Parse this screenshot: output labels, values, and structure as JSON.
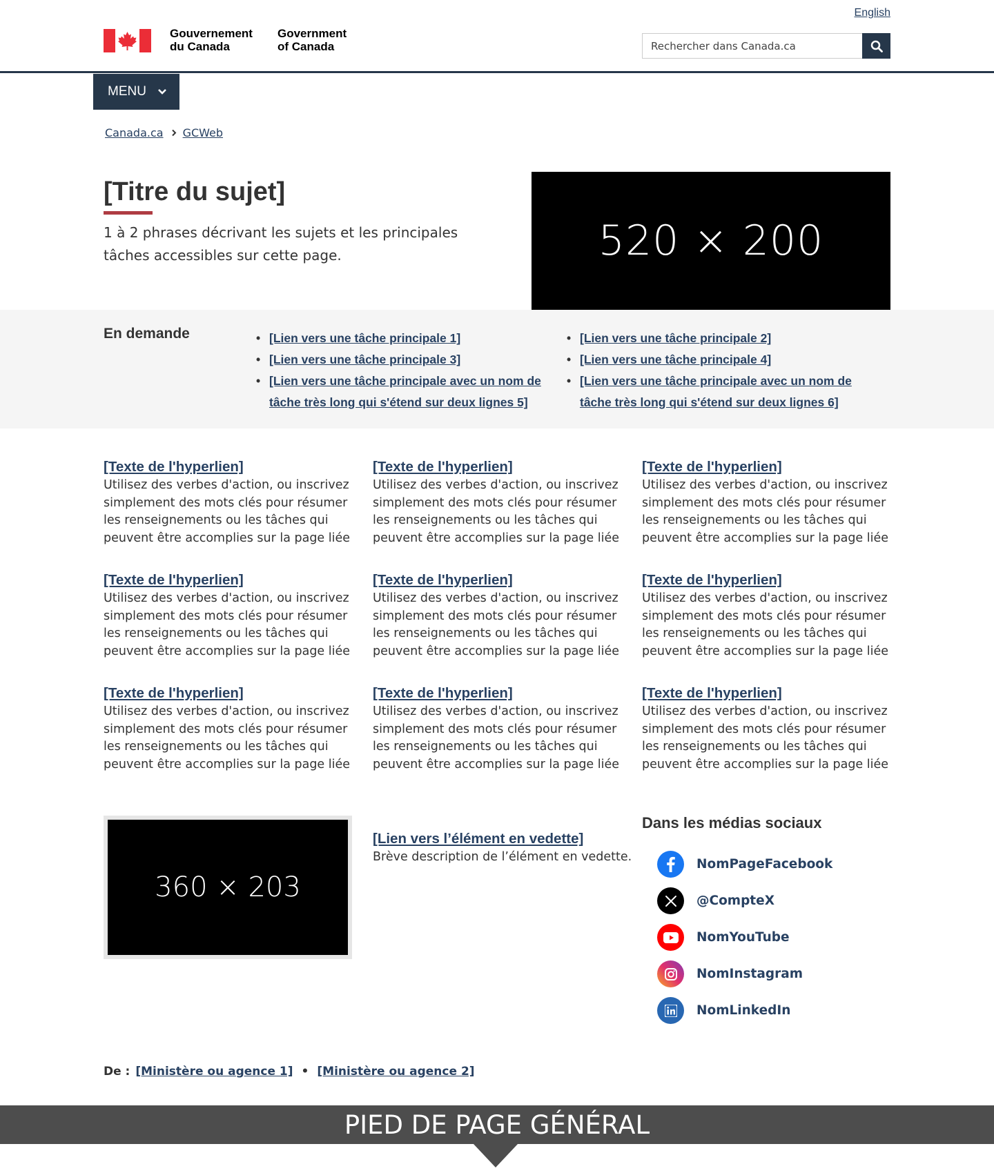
{
  "header": {
    "lang_link": "English",
    "signature_fr": [
      "Gouvernement",
      "du Canada"
    ],
    "signature_en": [
      "Government",
      "of Canada"
    ],
    "search": {
      "placeholder": "Rechercher dans Canada.ca",
      "button_icon": "search-icon"
    },
    "menu_label": "MENU"
  },
  "breadcrumb": [
    "Canada.ca",
    "GCWeb"
  ],
  "hero": {
    "title": "[Titre du sujet]",
    "intro": "1 à 2 phrases décrivant les sujets et les principales tâches accessibles sur cette page.",
    "image_label": "520 × 200"
  },
  "most_requested": {
    "heading": "En demande",
    "col1": [
      "[Lien vers une tâche principale 1]",
      "[Lien vers une tâche principale 3]",
      "[Lien vers une tâche principale avec un nom de tâche très long qui s'étend sur deux lignes 5]"
    ],
    "col2": [
      "[Lien vers une tâche principale 2]",
      "[Lien vers une tâche principale 4]",
      "[Lien vers une tâche principale avec un nom de tâche très long qui s'étend sur deux lignes 6]"
    ]
  },
  "links": [
    {
      "title": "[Texte de l'hyperlien]",
      "desc": "Utilisez des verbes d'action, ou inscrivez simplement des mots clés pour résumer les renseignements ou les tâches qui peuvent être accomplies sur la page liée"
    },
    {
      "title": "[Texte de l'hyperlien]",
      "desc": "Utilisez des verbes d'action, ou inscrivez simplement des mots clés pour résumer les renseignements ou les tâches qui peuvent être accomplies sur la page liée"
    },
    {
      "title": "[Texte de l'hyperlien]",
      "desc": "Utilisez des verbes d'action, ou inscrivez simplement des mots clés pour résumer les renseignements ou les tâches qui peuvent être accomplies sur la page liée"
    },
    {
      "title": "[Texte de l'hyperlien]",
      "desc": "Utilisez des verbes d'action, ou inscrivez simplement des mots clés pour résumer les renseignements ou les tâches qui peuvent être accomplies sur la page liée"
    },
    {
      "title": "[Texte de l'hyperlien]",
      "desc": "Utilisez des verbes d'action, ou inscrivez simplement des mots clés pour résumer les renseignements ou les tâches qui peuvent être accomplies sur la page liée"
    },
    {
      "title": "[Texte de l'hyperlien]",
      "desc": "Utilisez des verbes d'action, ou inscrivez simplement des mots clés pour résumer les renseignements ou les tâches qui peuvent être accomplies sur la page liée"
    },
    {
      "title": "[Texte de l'hyperlien]",
      "desc": "Utilisez des verbes d'action, ou inscrivez simplement des mots clés pour résumer les renseignements ou les tâches qui peuvent être accomplies sur la page liée"
    },
    {
      "title": "[Texte de l'hyperlien]",
      "desc": "Utilisez des verbes d'action, ou inscrivez simplement des mots clés pour résumer les renseignements ou les tâches qui peuvent être accomplies sur la page liée"
    },
    {
      "title": "[Texte de l'hyperlien]",
      "desc": "Utilisez des verbes d'action, ou inscrivez simplement des mots clés pour résumer les renseignements ou les tâches qui peuvent être accomplies sur la page liée"
    }
  ],
  "featured": {
    "image_label": "360 × 203",
    "link": "[Lien vers l’élément en vedette]",
    "desc": "Brève description de l’élément en vedette."
  },
  "social": {
    "heading": "Dans les médias sociaux",
    "items": [
      {
        "label": "NomPageFacebook",
        "icon": "facebook-icon",
        "color": "#1877f2"
      },
      {
        "label": "@CompteX",
        "icon": "x-icon",
        "color": "#000000"
      },
      {
        "label": "NomYouTube",
        "icon": "youtube-icon",
        "color": "#ff0000"
      },
      {
        "label": "NomInstagram",
        "icon": "instagram-icon",
        "color": "#c13584"
      },
      {
        "label": "NomLinkedIn",
        "icon": "linkedin-icon",
        "color": "#2867b2"
      }
    ]
  },
  "departments": {
    "label": "De :",
    "items": [
      "[Ministère ou agence 1]",
      "[Ministère ou agence 2]"
    ]
  },
  "footer_banner": "PIED DE PAGE GÉNÉRAL",
  "colors": {
    "primary": "#26374a",
    "link": "#284162",
    "accent": "#af3c43",
    "flag_red": "#eb2d37",
    "band_bg": "#f5f5f5",
    "footer_bg": "#4d4d4d"
  }
}
